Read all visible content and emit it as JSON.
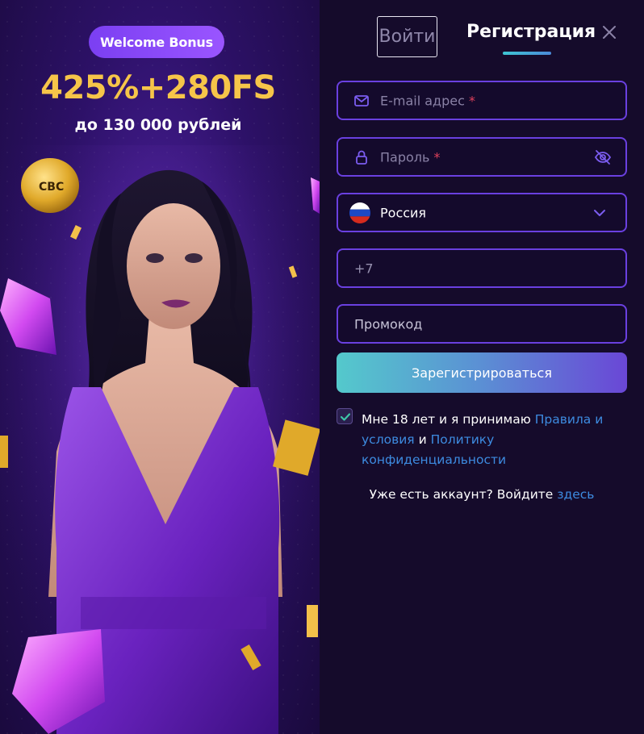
{
  "promo": {
    "badge": "Welcome Bonus",
    "amount": "425%+280FS",
    "subtitle": "до 130 000 рублей",
    "coin_text": "CBC"
  },
  "tabs": {
    "login": "Войти",
    "register": "Регистрация"
  },
  "form": {
    "email_placeholder": "E-mail адрес",
    "password_placeholder": "Пароль",
    "required_mark": "*",
    "country_value": "Россия",
    "phone_prefix": "+7",
    "promo_placeholder": "Промокод",
    "submit_label": "Зарегистрироваться"
  },
  "agreement": {
    "text_before": "Мне 18 лет и я принимаю",
    "terms_link": "Правила и условия",
    "and": "и",
    "privacy_link": "Политику конфиденциальности",
    "checked": true
  },
  "footer": {
    "have_account": "Уже есть аккаунт? Войдите",
    "here_link": "здесь"
  },
  "colors": {
    "accent": "#6a40e0",
    "gold": "#f6c549",
    "link": "#3d8be0",
    "required": "#e0415c",
    "panel_bg": "#150b2b"
  }
}
